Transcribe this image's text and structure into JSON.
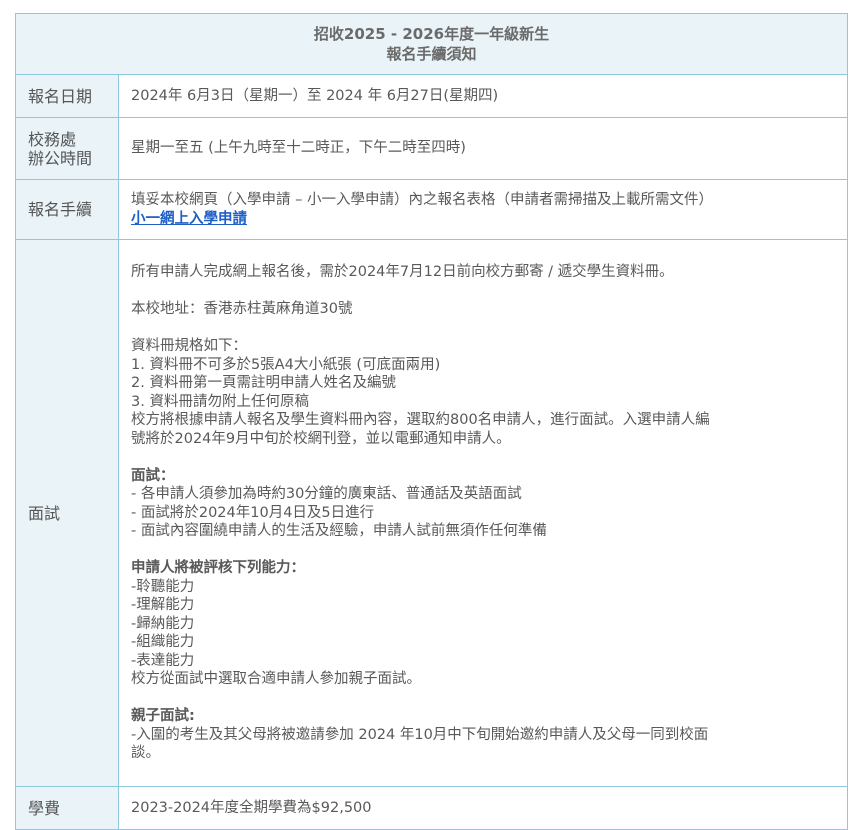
{
  "header": {
    "title_line1": "招收2025 - 2026年度一年級新生",
    "title_line2": "報名手續須知"
  },
  "rows": {
    "date": {
      "label": "報名日期",
      "value": "2024年 6月3日（星期一）至 2024 年 6月27日(星期四)"
    },
    "office": {
      "label_line1": "校務處",
      "label_line2": "辦公時間",
      "value": "星期一至五 (上午九時至十二時正，下午二時至四時)"
    },
    "apply": {
      "label": "報名手續",
      "value": "填妥本校網頁（入學申請 – 小一入學申請）內之報名表格（申請者需掃描及上載所需文件）",
      "link": "小一網上入學申請"
    },
    "interview": {
      "label": "面試",
      "p1": "所有申請人完成網上報名後，需於2024年7月12日前向校方郵寄 / 遞交學生資料冊。",
      "address": "本校地址：香港赤柱黃麻角道30號",
      "spec_title": "資料冊規格如下：",
      "spec_items": [
        "1. 資料冊不可多於5張A4大小紙張 (可底面兩用)",
        "2. 資料冊第一頁需註明申請人姓名及編號",
        "3. 資料冊請勿附上任何原稿"
      ],
      "selection_line1": "校方將根據申請人報名及學生資料冊內容，選取約800名申請人，進行面試。入選申請人編",
      "selection_line2": "號將於2024年9月中旬於校網刊登，並以電郵通知申請人。",
      "interview_title": "面試：",
      "interview_items": [
        "- 各申請人須參加為時約30分鐘的廣東話、普通話及英語面試",
        "- 面試將於2024年10月4日及5日進行",
        "- 面試內容圍繞申請人的生活及經驗，申請人試前無須作任何準備"
      ],
      "ability_title": "申請人將被評核下列能力：",
      "ability_items": [
        "-聆聽能力",
        "-理解能力",
        "-歸納能力",
        "-組織能力",
        "-表達能力"
      ],
      "ability_note": "校方從面試中選取合適申請人參加親子面試。",
      "parent_title": "親子面試:",
      "parent_line1": "-入圍的考生及其父母將被邀請參加 2024 年10月中下旬開始邀約申請人及父母一同到校面",
      "parent_line2": "談。"
    },
    "fee": {
      "label": "學費",
      "value": "2023-2024年度全期學費為$92,500"
    }
  }
}
